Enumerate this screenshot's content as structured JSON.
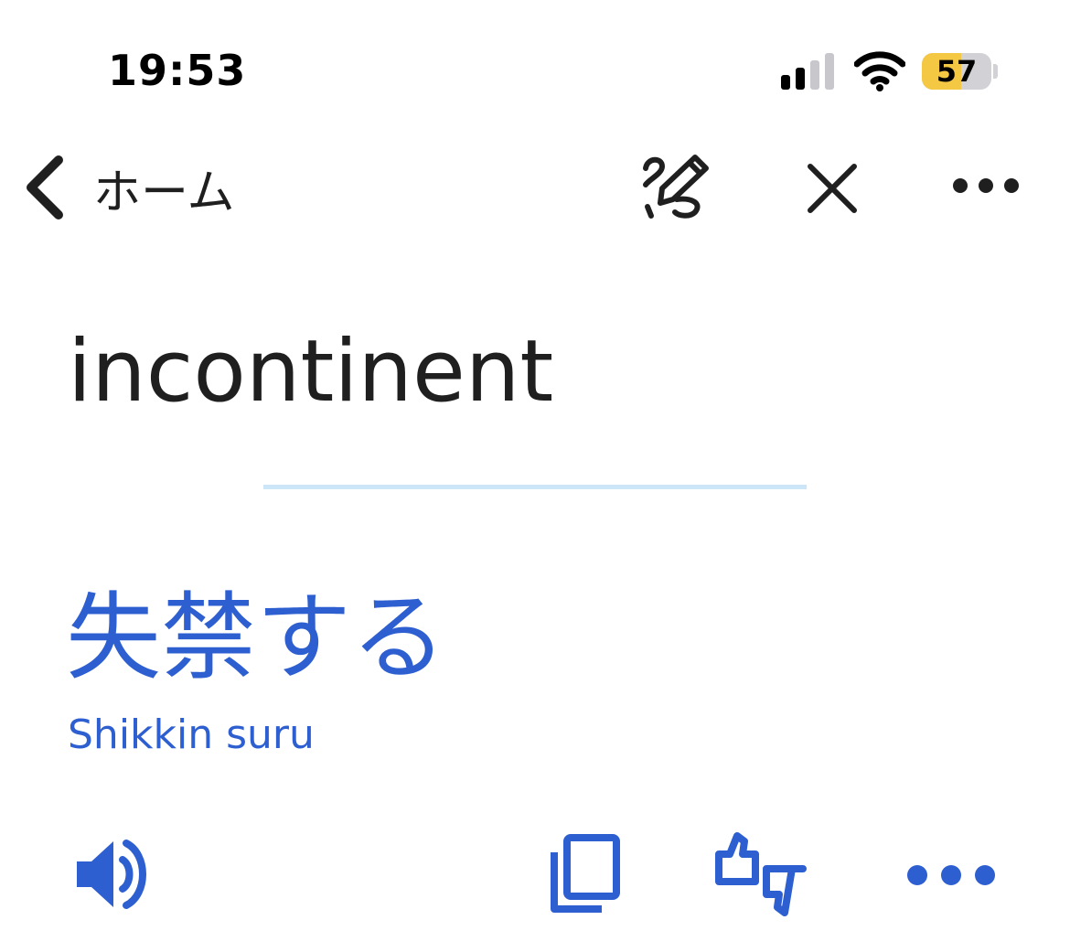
{
  "status_bar": {
    "time": "19:53",
    "battery_percent": "57",
    "battery_level": 0.57,
    "signal_icon": "cellular-signal-icon",
    "wifi_icon": "wifi-icon"
  },
  "nav": {
    "back_label": "ホーム",
    "back_icon": "chevron-left-icon",
    "handwriting_icon": "handwriting-pen-icon",
    "close_icon": "close-icon",
    "more_icon": "more-horizontal-icon"
  },
  "translation": {
    "source_text": "incontinent",
    "target_text": "失禁する",
    "romanization": "Shikkin suru"
  },
  "actions": {
    "speak_icon": "speaker-icon",
    "copy_icon": "copy-icon",
    "feedback_icon": "thumbs-up-down-icon",
    "more_icon": "more-horizontal-icon"
  },
  "colors": {
    "accent": "#2d5fd1",
    "text": "#1f1f1f",
    "divider": "#cde6f7",
    "battery_fill": "#f4c842"
  }
}
